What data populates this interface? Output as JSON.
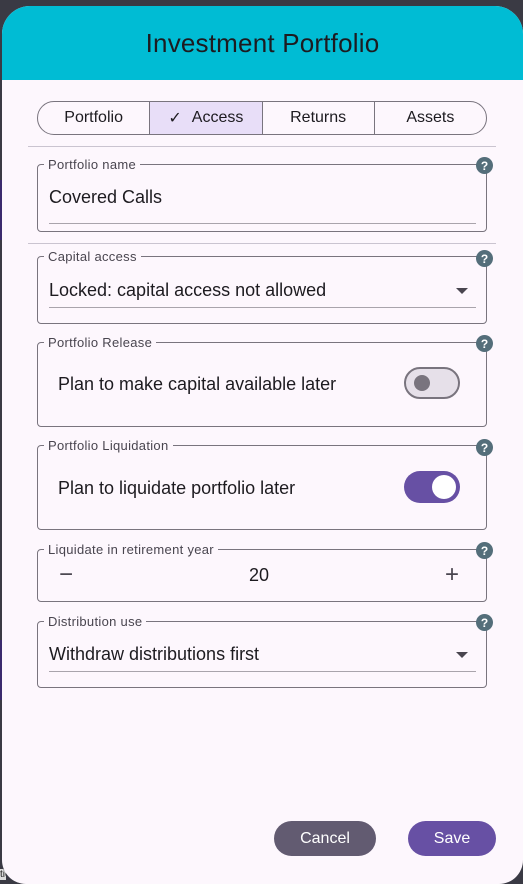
{
  "dialog": {
    "title": "Investment Portfolio"
  },
  "tabs": [
    {
      "label": "Portfolio",
      "selected": false
    },
    {
      "label": "Access",
      "selected": true
    },
    {
      "label": "Returns",
      "selected": false
    },
    {
      "label": "Assets",
      "selected": false
    }
  ],
  "fields": {
    "portfolio_name": {
      "label": "Portfolio name",
      "value": "Covered Calls"
    },
    "capital_access": {
      "label": "Capital access",
      "value": "Locked: capital access not allowed"
    },
    "portfolio_release": {
      "label": "Portfolio Release",
      "text": "Plan to make capital available later",
      "enabled": false
    },
    "portfolio_liquidation": {
      "label": "Portfolio Liquidation",
      "text": "Plan to liquidate portfolio later",
      "enabled": true
    },
    "liquidate_year": {
      "label": "Liquidate in retirement year",
      "value": "20",
      "minus": "−",
      "plus": "+"
    },
    "distribution_use": {
      "label": "Distribution use",
      "value": "Withdraw distributions first"
    }
  },
  "help_glyph": "?",
  "check_glyph": "✓",
  "actions": {
    "cancel": "Cancel",
    "save": "Save"
  },
  "backdrop_text": "tic",
  "colors": {
    "header": "#00bcd4",
    "primary": "#6750a4",
    "secondary": "#625b71",
    "selected_segment": "#e8def8"
  }
}
